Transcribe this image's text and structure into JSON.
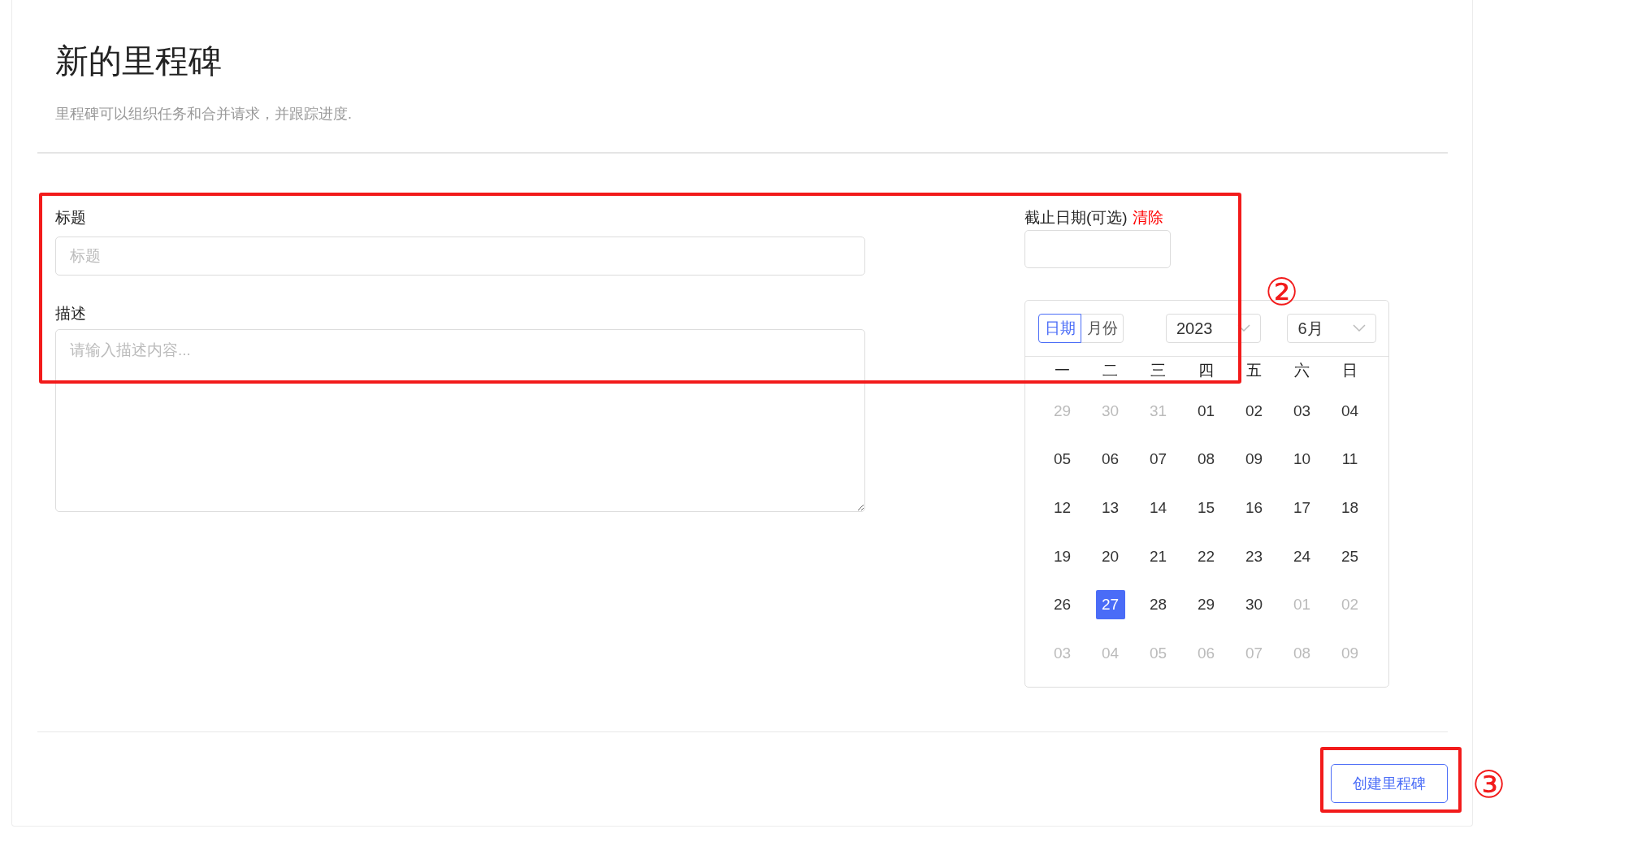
{
  "header": {
    "title": "新的里程碑",
    "subtitle": "里程碑可以组织任务和合并请求，并跟踪进度."
  },
  "title_field": {
    "label": "标题",
    "placeholder": "标题"
  },
  "description_field": {
    "label": "描述",
    "placeholder": "请输入描述内容..."
  },
  "due_date": {
    "label": "截止日期(可选)",
    "clear_link": "清除"
  },
  "calendar": {
    "modes": [
      {
        "label": "日期",
        "selected": true
      },
      {
        "label": "月份",
        "selected": false
      }
    ],
    "year": "2023",
    "month": "6月",
    "weekdays": [
      "一",
      "二",
      "三",
      "四",
      "五",
      "六",
      "日"
    ],
    "weeks": [
      [
        {
          "day": "29",
          "in_month": false,
          "selected": false
        },
        {
          "day": "30",
          "in_month": false,
          "selected": false
        },
        {
          "day": "31",
          "in_month": false,
          "selected": false
        },
        {
          "day": "01",
          "in_month": true,
          "selected": false
        },
        {
          "day": "02",
          "in_month": true,
          "selected": false
        },
        {
          "day": "03",
          "in_month": true,
          "selected": false
        },
        {
          "day": "04",
          "in_month": true,
          "selected": false
        }
      ],
      [
        {
          "day": "05",
          "in_month": true,
          "selected": false
        },
        {
          "day": "06",
          "in_month": true,
          "selected": false
        },
        {
          "day": "07",
          "in_month": true,
          "selected": false
        },
        {
          "day": "08",
          "in_month": true,
          "selected": false
        },
        {
          "day": "09",
          "in_month": true,
          "selected": false
        },
        {
          "day": "10",
          "in_month": true,
          "selected": false
        },
        {
          "day": "11",
          "in_month": true,
          "selected": false
        }
      ],
      [
        {
          "day": "12",
          "in_month": true,
          "selected": false
        },
        {
          "day": "13",
          "in_month": true,
          "selected": false
        },
        {
          "day": "14",
          "in_month": true,
          "selected": false
        },
        {
          "day": "15",
          "in_month": true,
          "selected": false
        },
        {
          "day": "16",
          "in_month": true,
          "selected": false
        },
        {
          "day": "17",
          "in_month": true,
          "selected": false
        },
        {
          "day": "18",
          "in_month": true,
          "selected": false
        }
      ],
      [
        {
          "day": "19",
          "in_month": true,
          "selected": false
        },
        {
          "day": "20",
          "in_month": true,
          "selected": false
        },
        {
          "day": "21",
          "in_month": true,
          "selected": false
        },
        {
          "day": "22",
          "in_month": true,
          "selected": false
        },
        {
          "day": "23",
          "in_month": true,
          "selected": false
        },
        {
          "day": "24",
          "in_month": true,
          "selected": false
        },
        {
          "day": "25",
          "in_month": true,
          "selected": false
        }
      ],
      [
        {
          "day": "26",
          "in_month": true,
          "selected": false
        },
        {
          "day": "27",
          "in_month": true,
          "selected": true
        },
        {
          "day": "28",
          "in_month": true,
          "selected": false
        },
        {
          "day": "29",
          "in_month": true,
          "selected": false
        },
        {
          "day": "30",
          "in_month": true,
          "selected": false
        },
        {
          "day": "01",
          "in_month": false,
          "selected": false
        },
        {
          "day": "02",
          "in_month": false,
          "selected": false
        }
      ],
      [
        {
          "day": "03",
          "in_month": false,
          "selected": false
        },
        {
          "day": "04",
          "in_month": false,
          "selected": false
        },
        {
          "day": "05",
          "in_month": false,
          "selected": false
        },
        {
          "day": "06",
          "in_month": false,
          "selected": false
        },
        {
          "day": "07",
          "in_month": false,
          "selected": false
        },
        {
          "day": "08",
          "in_month": false,
          "selected": false
        },
        {
          "day": "09",
          "in_month": false,
          "selected": false
        }
      ]
    ]
  },
  "submit_button": "创建里程碑",
  "annotation_markers": [
    "②",
    "③"
  ]
}
